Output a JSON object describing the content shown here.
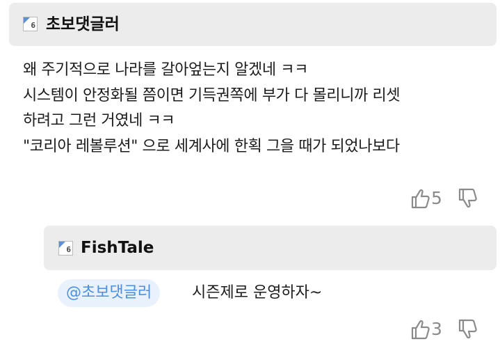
{
  "comment": {
    "author": "초보댓글러",
    "level": "6",
    "lines": [
      "왜 주기적으로 나라를 갈아엎는지 알겠네 ㅋㅋ",
      "시스템이 안정화될 쯤이면 기득권쪽에 부가 다 몰리니까 리셋",
      "하려고 그런 거였네 ㅋㅋ",
      "\"코리아 레볼루션\" 으로 세계사에 한획 그을 때가 되었나보다"
    ],
    "likes": "5"
  },
  "reply": {
    "author": "FishTale",
    "level": "6",
    "mention": "@초보댓글러",
    "text": "시즌제로 운영하자~",
    "likes": "3"
  },
  "colors": {
    "header_bg": "#ececec",
    "mention_bg": "#e8f1fc",
    "mention_text": "#4a8fe0",
    "count_text": "#8a8a8a"
  },
  "icons": [
    "level-badge-icon",
    "thumbs-up-icon",
    "thumbs-down-icon"
  ]
}
